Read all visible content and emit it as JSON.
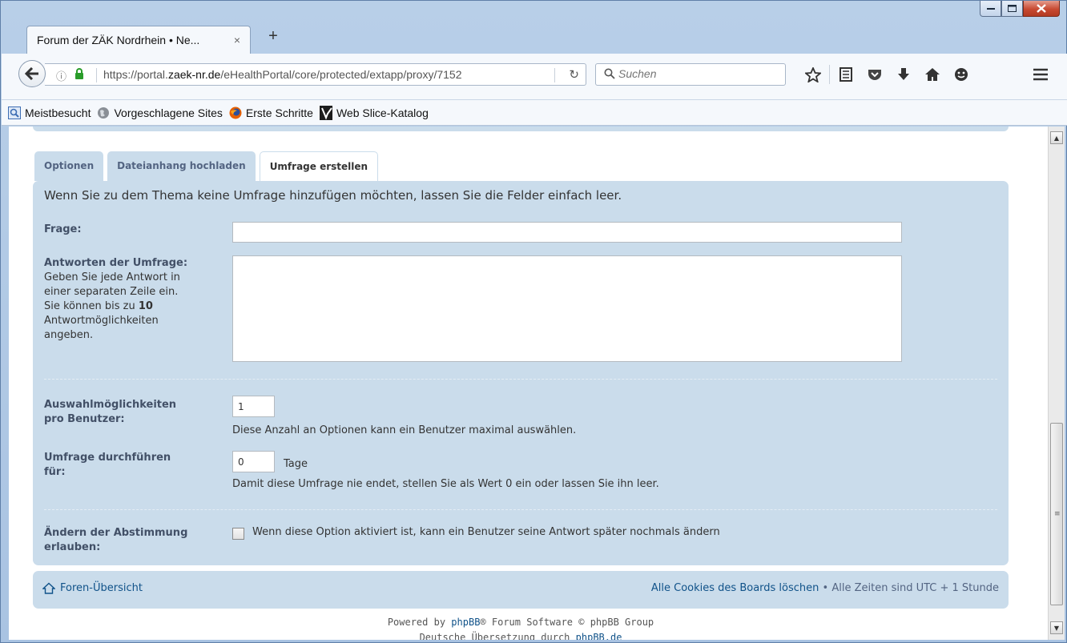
{
  "browser": {
    "tab_title": "Forum der ZÄK Nordrhein • Ne...",
    "tab_close": "×",
    "new_tab": "+",
    "url_prefix": "https://portal.",
    "url_domain": "zaek-nr.de",
    "url_path": "/eHealthPortal/core/protected/extapp/proxy/7152",
    "search_placeholder": "Suchen",
    "bookmarks": [
      {
        "label": "Meistbesucht",
        "icon": "most-visited-icon"
      },
      {
        "label": "Vorgeschlagene Sites",
        "icon": "globe-icon"
      },
      {
        "label": "Erste Schritte",
        "icon": "firefox-icon"
      },
      {
        "label": "Web Slice-Katalog",
        "icon": "web-slice-icon"
      }
    ]
  },
  "tabs": [
    {
      "label": "Optionen",
      "active": false
    },
    {
      "label": "Dateianhang hochladen",
      "active": false
    },
    {
      "label": "Umfrage erstellen",
      "active": true
    }
  ],
  "poll": {
    "intro": "Wenn Sie zu dem Thema keine Umfrage hinzufügen möchten, lassen Sie die Felder einfach leer.",
    "question_label": "Frage:",
    "question_value": "",
    "answers_label": "Antworten der Umfrage:",
    "answers_desc_line1": "Geben Sie jede Antwort in",
    "answers_desc_line2": "einer separaten Zeile ein.",
    "answers_desc_line3_pre": "Sie können bis zu ",
    "answers_max": "10",
    "answers_desc_line4": "Antwortmöglichkeiten",
    "answers_desc_line5": "angeben.",
    "answers_value": "",
    "max_options_label_1": "Auswahlmöglichkeiten",
    "max_options_label_2": "pro Benutzer:",
    "max_options_value": "1",
    "max_options_hint": "Diese Anzahl an Optionen kann ein Benutzer maximal auswählen.",
    "duration_label_1": "Umfrage durchführen",
    "duration_label_2": "für:",
    "duration_value": "0",
    "duration_unit": "Tage",
    "duration_hint": "Damit diese Umfrage nie endet, stellen Sie als Wert 0 ein oder lassen Sie ihn leer.",
    "change_vote_label_1": "Ändern der Abstimmung",
    "change_vote_label_2": "erlauben:",
    "change_vote_text": "Wenn diese Option aktiviert ist, kann ein Benutzer seine Antwort später nochmals ändern",
    "change_vote_checked": false
  },
  "footer": {
    "index_link": "Foren-Übersicht",
    "cookies_link": "Alle Cookies des Boards löschen",
    "separator": " • ",
    "timezone": "Alle Zeiten sind UTC + 1 Stunde",
    "powered_pre": "Powered by ",
    "powered_link": "phpBB",
    "powered_post": "® Forum Software © phpBB Group",
    "translation_pre": "Deutsche Übersetzung durch ",
    "translation_link": "phpBB.de"
  }
}
